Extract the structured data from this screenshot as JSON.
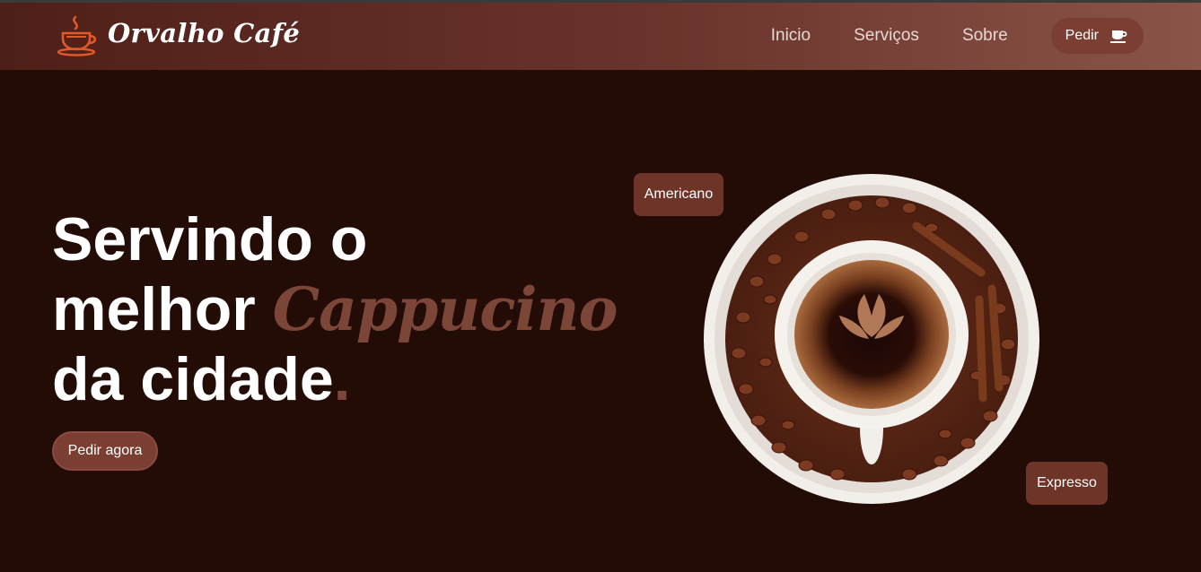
{
  "brand": {
    "name": "Orvalho Café",
    "logo_icon": "coffee-cup-steam-icon",
    "logo_color": "#e25a2a"
  },
  "nav": {
    "links": [
      {
        "label": "Inicio"
      },
      {
        "label": "Serviços"
      },
      {
        "label": "Sobre"
      }
    ],
    "order_button": {
      "label": "Pedir",
      "icon": "coffee-cup-icon"
    }
  },
  "hero": {
    "title_line1": "Servindo o",
    "title_line2": "melhor",
    "title_highlight": "Cappucino",
    "title_line3": "da cidade",
    "title_dot": ".",
    "cta_label": "Pedir agora"
  },
  "product_tags": {
    "americano": "Americano",
    "expresso": "Expresso"
  },
  "colors": {
    "background": "#220c05",
    "accent": "#7b3e33",
    "highlight_text": "#7b4637"
  }
}
